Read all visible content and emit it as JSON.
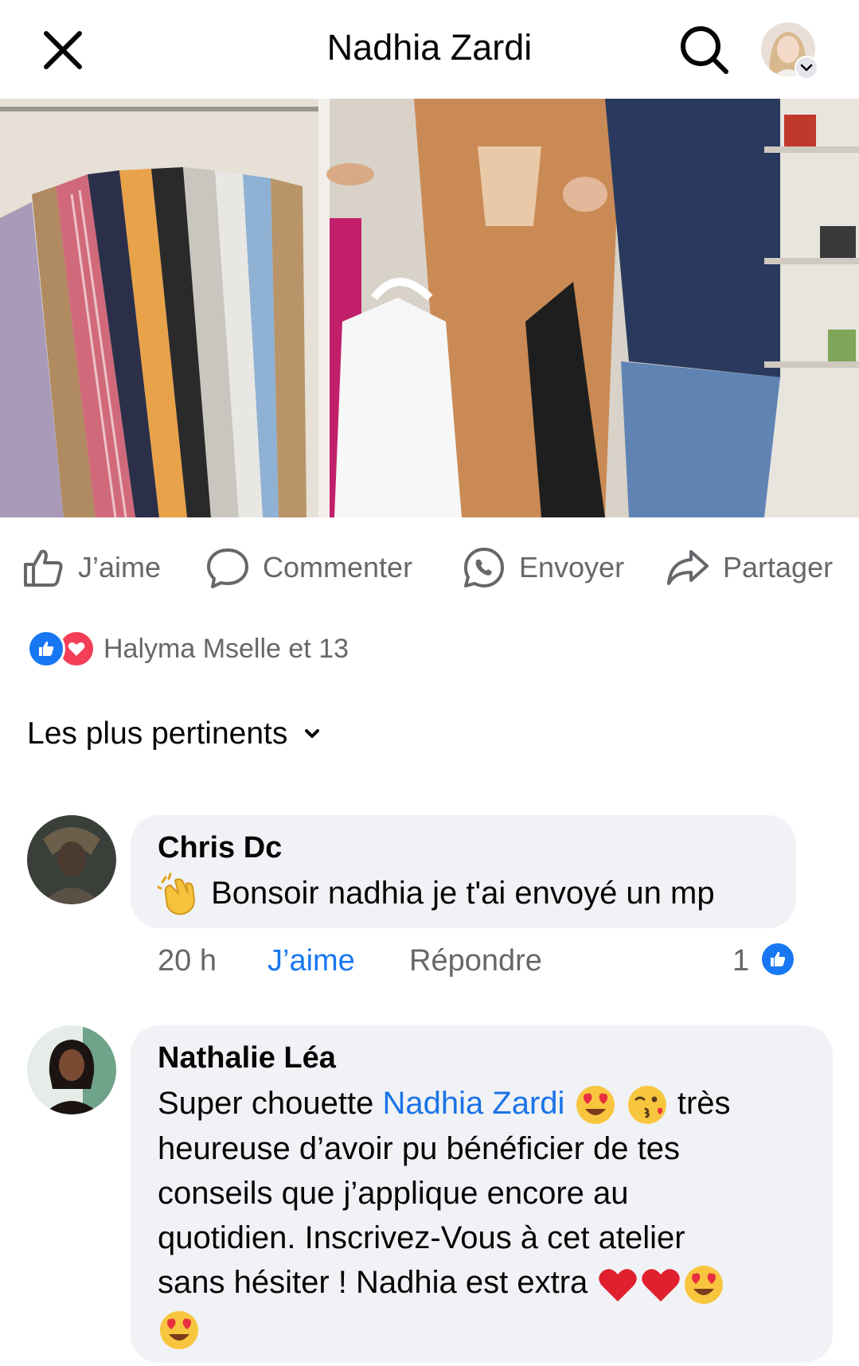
{
  "header": {
    "title": "Nadhia Zardi",
    "close_icon": "close-icon",
    "search_icon": "search-icon",
    "profile_icon": "profile-avatar"
  },
  "actions": {
    "like_label": "J’aime",
    "comment_label": "Commenter",
    "send_label": "Envoyer",
    "share_label": "Partager"
  },
  "reactions": {
    "text": "Halyma Mselle et 13",
    "types": [
      "like",
      "love"
    ]
  },
  "sort": {
    "label": "Les plus pertinents"
  },
  "comments": [
    {
      "author": "Chris Dc",
      "emoji_prefix": "clapping-hands",
      "text": "Bonsoir nadhia je t'ai envoyé un mp",
      "time": "20 h",
      "like_label": "J’aime",
      "reply_label": "Répondre",
      "like_count": "1"
    },
    {
      "author": "Nathalie Léa",
      "text_part1": "Super chouette",
      "mention": "Nadhia Zardi",
      "text_part2": "très",
      "line2": "heureuse d’avoir pu bénéficier de tes",
      "line3": "conseils que j’applique encore au",
      "line4": "quotidien. Inscrivez-Vous à cet atelier",
      "line5": "sans hésiter ! Nadhia est extra"
    }
  ],
  "colors": {
    "accent": "#1877f2",
    "love": "#f33e58",
    "secondary_text": "#65676b",
    "bubble_bg": "#f0f2f5"
  }
}
